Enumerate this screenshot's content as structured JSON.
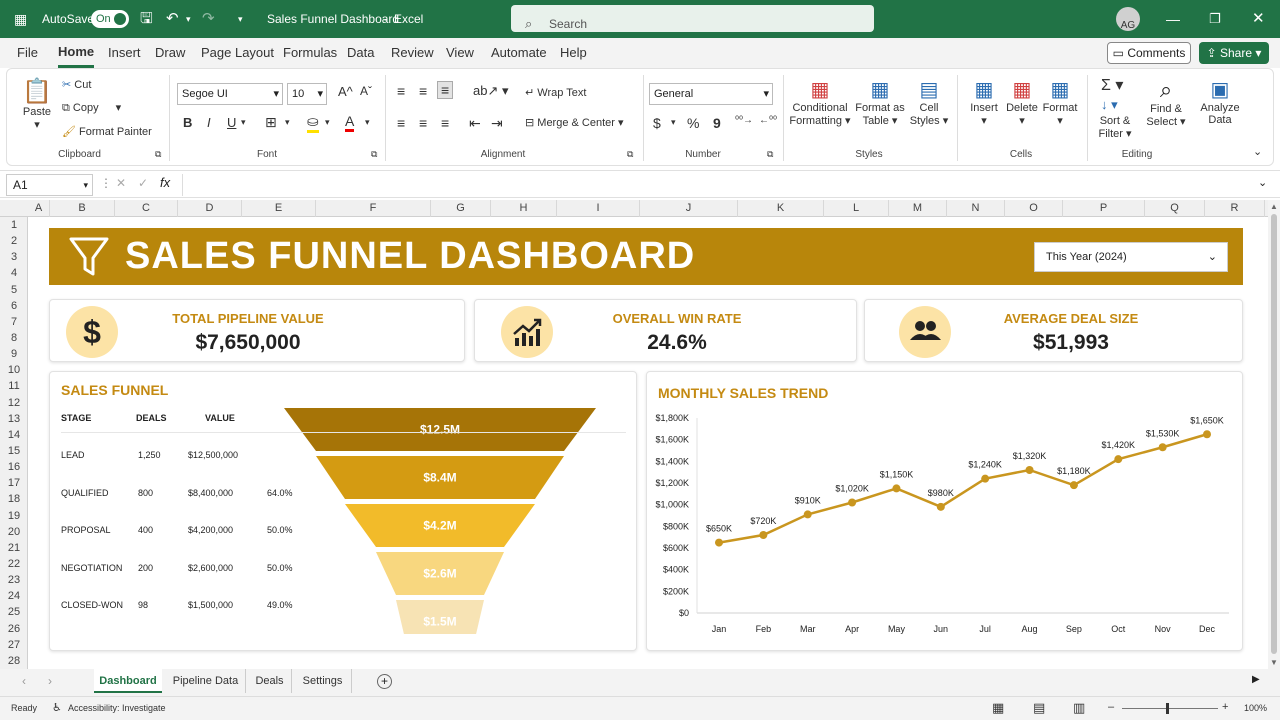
{
  "titlebar": {
    "autosave_label": "AutoSave",
    "autosave_state": "On",
    "doc_title": "Sales Funnel Dashboard",
    "separator": "-",
    "app_name": "Excel",
    "search_placeholder": "Search",
    "user_initials": "AG"
  },
  "menu": {
    "tabs": [
      "File",
      "Home",
      "Insert",
      "Draw",
      "Page Layout",
      "Formulas",
      "Data",
      "Review",
      "View",
      "Automate",
      "Help"
    ],
    "active_tab": "Home",
    "comments_label": "Comments",
    "share_label": "Share"
  },
  "ribbon": {
    "clipboard": {
      "paste": "Paste",
      "cut": "Cut",
      "copy": "Copy",
      "format_painter": "Format Painter",
      "group": "Clipboard"
    },
    "font": {
      "font_name": "Segoe UI",
      "font_size": "10",
      "bold": "B",
      "italic": "I",
      "underline": "U",
      "group": "Font"
    },
    "alignment": {
      "wrap_text": "Wrap Text",
      "merge_center": "Merge & Center",
      "group": "Alignment"
    },
    "number": {
      "format": "General",
      "currency": "$",
      "percent": "%",
      "comma": "9",
      "group": "Number"
    },
    "styles": {
      "conditional": "Conditional",
      "conditional2": "Formatting",
      "format_as": "Format as",
      "format_as2": "Table",
      "cell_styles": "Cell",
      "cell_styles2": "Styles",
      "group": "Styles"
    },
    "cells": {
      "insert": "Insert",
      "delete": "Delete",
      "format": "Format",
      "group": "Cells"
    },
    "editing": {
      "sort": "Sort &",
      "sort2": "Filter",
      "find": "Find &",
      "find2": "Select",
      "group": "Editing"
    },
    "analyze": {
      "label": "Analyze",
      "label2": "Data"
    }
  },
  "formula_bar": {
    "name_box": "A1",
    "fx": "fx",
    "content": ""
  },
  "grid": {
    "columns": [
      "A",
      "B",
      "C",
      "D",
      "E",
      "F",
      "G",
      "H",
      "I",
      "J",
      "K",
      "L",
      "M",
      "N",
      "O",
      "P",
      "Q",
      "R"
    ],
    "rows": [
      "1",
      "2",
      "3",
      "4",
      "5",
      "6",
      "7",
      "8",
      "9",
      "10",
      "11",
      "12",
      "13",
      "14",
      "15",
      "16",
      "17",
      "18",
      "19",
      "20",
      "21",
      "22",
      "23",
      "24",
      "25",
      "26",
      "27",
      "28"
    ]
  },
  "dashboard": {
    "title": "SALES FUNNEL DASHBOARD",
    "period": "This Year (2024)",
    "kpis": [
      {
        "label": "TOTAL PIPELINE VALUE",
        "value": "$7,650,000",
        "icon": "dollar-icon"
      },
      {
        "label": "OVERALL WIN RATE",
        "value": "24.6%",
        "icon": "trend-chart-icon"
      },
      {
        "label": "AVERAGE DEAL SIZE",
        "value": "$51,993",
        "icon": "users-icon"
      }
    ],
    "funnel": {
      "title": "SALES FUNNEL",
      "headers": {
        "stage": "STAGE",
        "deals": "DEALS",
        "value": "VALUE"
      },
      "rows": [
        {
          "stage": "LEAD",
          "deals": "1,250",
          "value": "$12,500,000",
          "rate": ""
        },
        {
          "stage": "QUALIFIED",
          "deals": "800",
          "value": "$8,400,000",
          "rate": "64.0%"
        },
        {
          "stage": "PROPOSAL",
          "deals": "400",
          "value": "$4,200,000",
          "rate": "50.0%"
        },
        {
          "stage": "NEGOTIATION",
          "deals": "200",
          "value": "$2,600,000",
          "rate": "50.0%"
        },
        {
          "stage": "CLOSED-WON",
          "deals": "98",
          "value": "$1,500,000",
          "rate": "49.0%"
        }
      ],
      "segments": [
        {
          "label": "$12.5M",
          "color": "#a67407"
        },
        {
          "label": "$8.4M",
          "color": "#d49b12"
        },
        {
          "label": "$4.2M",
          "color": "#f2bb2a"
        },
        {
          "label": "$2.6M",
          "color": "#f8d77f"
        },
        {
          "label": "$1.5M",
          "color": "#f7e3b4"
        }
      ]
    }
  },
  "chart_data": {
    "type": "line",
    "title": "MONTHLY SALES TREND",
    "categories": [
      "Jan",
      "Feb",
      "Mar",
      "Apr",
      "May",
      "Jun",
      "Jul",
      "Aug",
      "Sep",
      "Oct",
      "Nov",
      "Dec"
    ],
    "values": [
      650,
      720,
      910,
      1020,
      1150,
      980,
      1240,
      1320,
      1180,
      1420,
      1530,
      1650
    ],
    "value_labels": [
      "$650K",
      "$720K",
      "$910K",
      "$1,020K",
      "$1,150K",
      "$980K",
      "$1,240K",
      "$1,320K",
      "$1,180K",
      "$1,420K",
      "$1,530K",
      "$1,650K"
    ],
    "yticks": [
      "$0",
      "$200K",
      "$400K",
      "$600K",
      "$800K",
      "$1,000K",
      "$1,200K",
      "$1,400K",
      "$1,600K",
      "$1,800K"
    ],
    "ylim": [
      0,
      1800
    ],
    "line_color": "#c9961f",
    "grid": false
  },
  "sheet_tabs": {
    "tabs": [
      "Dashboard",
      "Pipeline Data",
      "Deals",
      "Settings"
    ],
    "active": "Dashboard",
    "add": "+"
  },
  "status": {
    "ready": "Ready",
    "accessibility": "Accessibility: Investigate",
    "zoom": "100%"
  }
}
